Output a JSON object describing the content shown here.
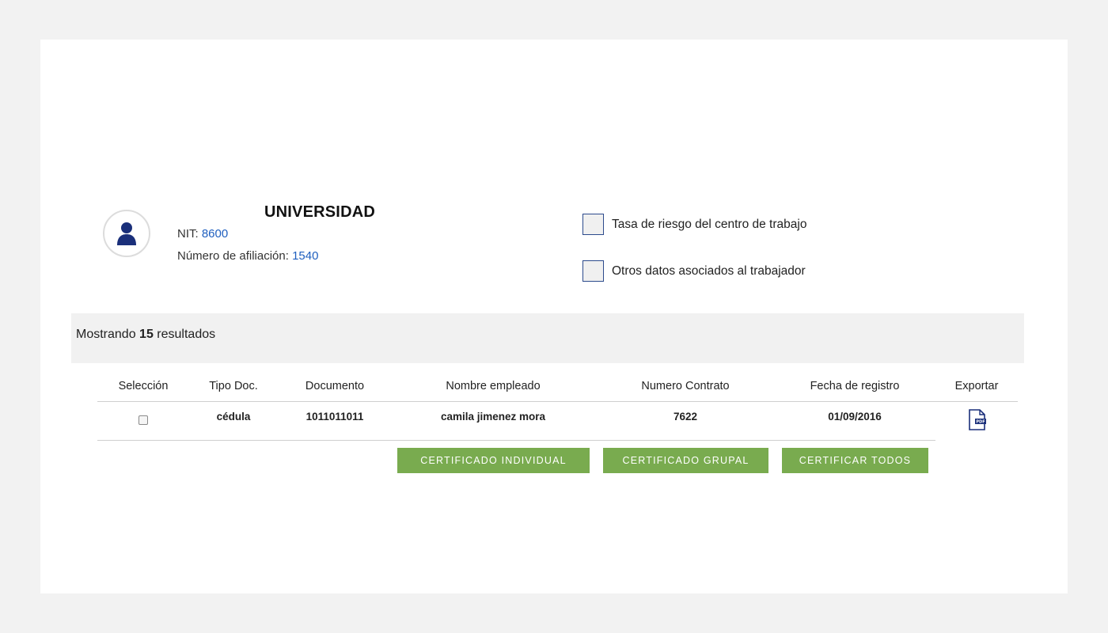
{
  "company": {
    "name": "UNIVERSIDAD",
    "nit_label": "NIT: ",
    "nit_value": "8600",
    "afiliacion_label": "Número de afiliación: ",
    "afiliacion_value": "1540"
  },
  "options": [
    {
      "label": "Tasa de riesgo del centro de trabajo",
      "checked": false
    },
    {
      "label": "Otros datos asociados al trabajador",
      "checked": false
    }
  ],
  "results": {
    "prefix": "Mostrando ",
    "count": "15",
    "suffix": " resultados"
  },
  "table": {
    "headers": [
      "Selección",
      "Tipo Doc.",
      "Documento",
      "Nombre empleado",
      "Numero Contrato",
      "Fecha de registro",
      "Exportar"
    ],
    "rows": [
      {
        "tipo": "cédula",
        "documento": "1011011011",
        "nombre": "camila jimenez mora",
        "contrato": "7622",
        "fecha": "01/09/2016",
        "export_icon": "pdf-icon"
      }
    ]
  },
  "buttons": {
    "individual": "CERTIFICADO INDIVIDUAL",
    "grupal": "CERTIFICADO GRUPAL",
    "todos": "CERTIFICAR TODOS"
  },
  "colors": {
    "accent_green": "#79ab4f",
    "link_blue": "#1f5fbf",
    "icon_navy": "#1a2f7a"
  }
}
